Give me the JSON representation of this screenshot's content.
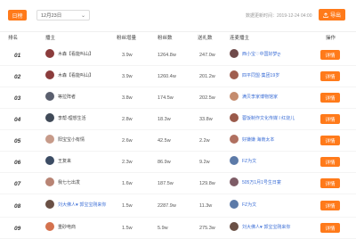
{
  "toolbar": {
    "day_tab": "日榜",
    "date": "12月23日",
    "updated": "数据更新时间：2019-12-24 04:00",
    "export_label": "导出",
    "export_icon": "upload-icon"
  },
  "columns": [
    "排名",
    "播主",
    "粉丝增量",
    "粉丝数",
    "送礼数",
    "连麦播主",
    "操作"
  ],
  "rows": [
    {
      "rank": "01",
      "name": "木森【看能叫山】",
      "inc": "3.9w",
      "fans": "1264.8w",
      "gift": "247.0w",
      "top": "西小宝♡中国好梦ღ",
      "action": "详情",
      "avatar": "#8b3c3c",
      "top_avatar": "#6f4a4a"
    },
    {
      "rank": "02",
      "name": "木森【看能叫山】",
      "inc": "3.9w",
      "fans": "1260.4w",
      "gift": "201.2w",
      "top": "四平同盟·集团19岁",
      "action": "详情",
      "avatar": "#8b3c3c",
      "top_avatar": "#a05e4f"
    },
    {
      "rank": "03",
      "name": "等拉阵者",
      "inc": "3.8w",
      "fans": "174.5w",
      "gift": "202.5w",
      "top": "满贝李家博物馆家",
      "action": "详情",
      "avatar": "#5a5f6e",
      "top_avatar": "#c58c6e"
    },
    {
      "rank": "04",
      "name": "李帮-理想生活",
      "inc": "2.8w",
      "fans": "18.3w",
      "gift": "33.8w",
      "top": "蓉饭制作文化传媒 I 红烧儿",
      "action": "详情",
      "avatar": "#404a58",
      "top_avatar": "#9a5a4a"
    },
    {
      "rank": "05",
      "name": "阳宝宝小有情",
      "inc": "2.6w",
      "fans": "42.5w",
      "gift": "2.2w",
      "top": "好嫌嫌 海南太本",
      "action": "详情",
      "avatar": "#c79b8a",
      "top_avatar": "#b07060"
    },
    {
      "rank": "06",
      "name": "王复来",
      "inc": "2.3w",
      "fans": "86.9w",
      "gift": "9.2w",
      "top": "FZ为文",
      "action": "详情",
      "avatar": "#3c4c64",
      "top_avatar": "#5c7aa8"
    },
    {
      "rank": "07",
      "name": "我七七出发",
      "inc": "1.6w",
      "fans": "187.5w",
      "gift": "129.8w",
      "top": "505万1月1号生日宴",
      "action": "详情",
      "avatar": "#b88474",
      "top_avatar": "#7e5c66"
    },
    {
      "rank": "08",
      "name": "刘大佛人♥ 郭宝宝刚来你",
      "inc": "1.5w",
      "fans": "2287.9w",
      "gift": "11.3w",
      "top": "FZ为文",
      "action": "详情",
      "avatar": "#6a5045",
      "top_avatar": "#5c7aa8"
    },
    {
      "rank": "09",
      "name": "重砂电商",
      "inc": "1.5w",
      "fans": "5.9w",
      "gift": "275.3w",
      "top": "刘大佛人♥ 郭宝宝刚来你",
      "action": "详情",
      "avatar": "#d4724e",
      "top_avatar": "#6a5045"
    }
  ]
}
